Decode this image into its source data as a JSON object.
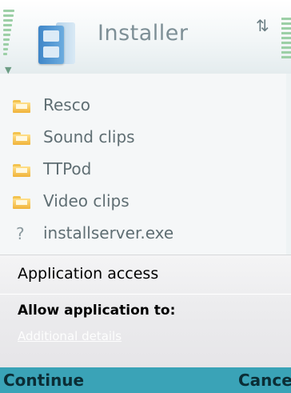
{
  "status": {
    "signal_icon": "antenna-signal-icon",
    "connectivity_icon": "network-connection-icon",
    "battery_icon": "battery-level-icon"
  },
  "header": {
    "title": "Installer",
    "app_icon": "file-cabinet-icon"
  },
  "list": {
    "items": [
      {
        "label": "Resco",
        "icon": "folder-icon"
      },
      {
        "label": "Sound clips",
        "icon": "folder-icon"
      },
      {
        "label": "TTPod",
        "icon": "folder-icon"
      },
      {
        "label": "Video clips",
        "icon": "folder-icon"
      },
      {
        "label": "installserver.exe",
        "icon": "unknown-file-icon",
        "icon_glyph": "?"
      }
    ]
  },
  "dialog": {
    "heading": "Application access",
    "prompt": "Allow application to:",
    "details_link": "Additional details"
  },
  "softkeys": {
    "left": "Continue",
    "right": "Cance"
  },
  "colors": {
    "softkey_bar": "#3aa3b7",
    "folder": "#f3c34f"
  }
}
